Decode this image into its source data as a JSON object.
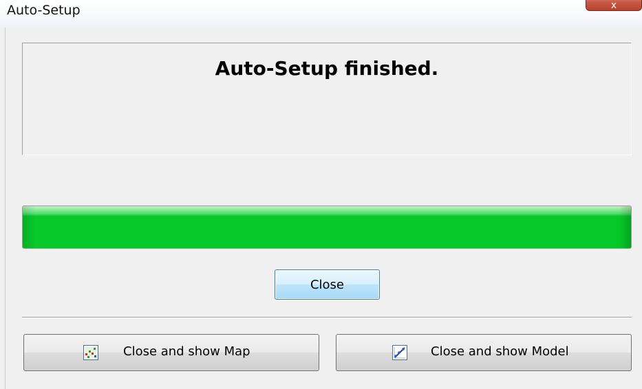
{
  "window": {
    "title": "Auto-Setup",
    "close_glyph": "x"
  },
  "message": {
    "text": "Auto-Setup finished."
  },
  "progress": {
    "value_percent": 100,
    "color": "#06c829"
  },
  "buttons": {
    "close_label": "Close",
    "close_map_label": "Close and show Map",
    "close_model_label": "Close and show Model"
  },
  "icons": {
    "map": "map-icon",
    "model": "model-icon"
  }
}
